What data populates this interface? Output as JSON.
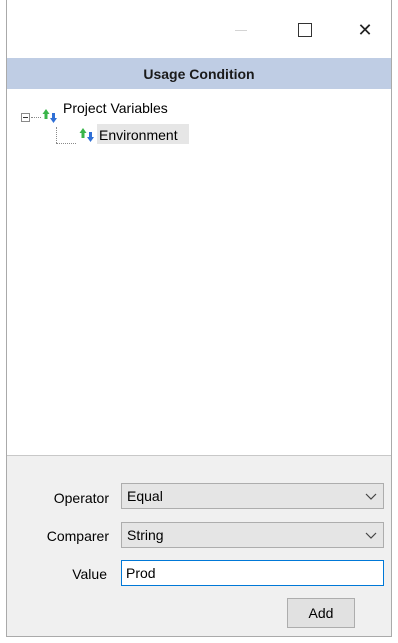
{
  "window": {
    "header_title": "Usage Condition",
    "close_glyph": "✕"
  },
  "tree": {
    "root": {
      "label": "Project Variables",
      "icon": "variables-icon",
      "expanded": true
    },
    "children": [
      {
        "label": "Environment",
        "icon": "variable-icon",
        "selected": true
      }
    ]
  },
  "form": {
    "operator": {
      "label": "Operator",
      "value": "Equal"
    },
    "comparer": {
      "label": "Comparer",
      "value": "String"
    },
    "value": {
      "label": "Value",
      "value": "Prod"
    },
    "add_button": "Add"
  },
  "colors": {
    "header_bg": "#bfcde4",
    "panel_bg": "#f0f0f0",
    "focus_border": "#0078d7",
    "arrow_up": "#3ab54a",
    "arrow_down": "#2f6fd6"
  }
}
